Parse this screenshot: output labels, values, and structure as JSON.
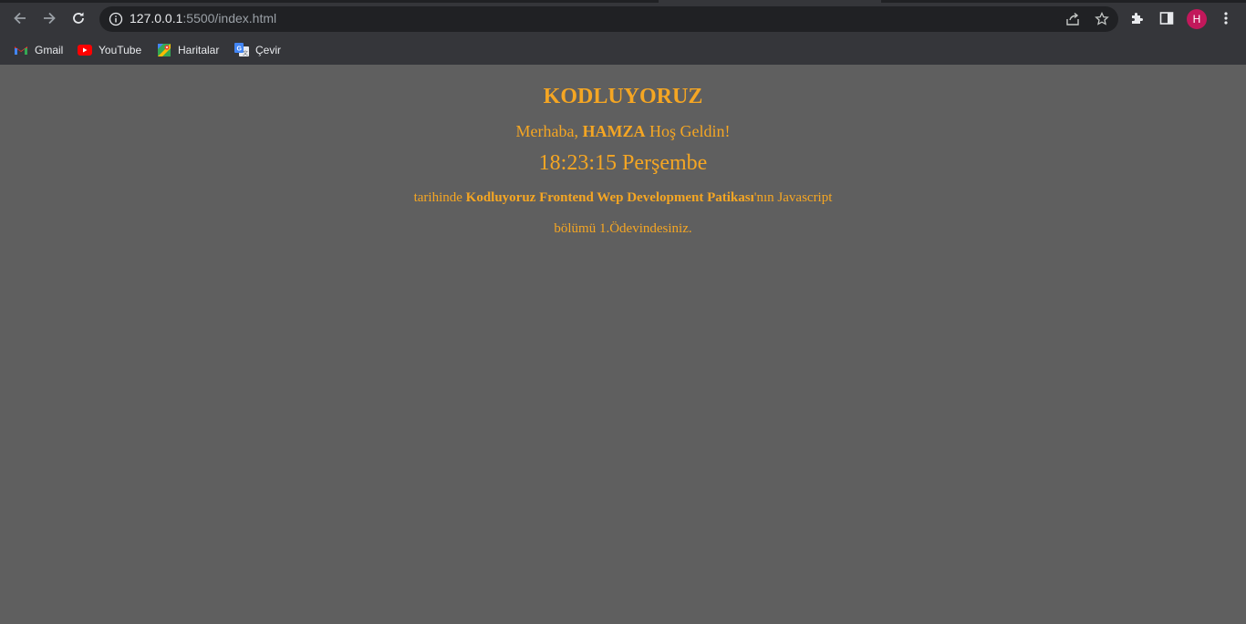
{
  "browser": {
    "url_host": "127.0.0.1",
    "url_rest": ":5500/index.html",
    "profile_initial": "H",
    "bookmarks": [
      {
        "label": "Gmail",
        "icon": "gmail-icon"
      },
      {
        "label": "YouTube",
        "icon": "youtube-icon"
      },
      {
        "label": "Haritalar",
        "icon": "maps-icon"
      },
      {
        "label": "Çevir",
        "icon": "translate-icon"
      }
    ]
  },
  "page": {
    "title": "KODLUYORUZ",
    "greeting_prefix": "Merhaba,",
    "user_name": "HAMZA",
    "greeting_suffix": "Hoş Geldin!",
    "clock": "18:23:15 Perşembe",
    "line1_prefix": "tarihinde",
    "line1_bold": "Kodluyoruz Frontend Wep Development Patikası",
    "line1_suffix": "'nın Javascript",
    "line2": "bölümü 1.Ödevindesiniz."
  },
  "colors": {
    "page_background": "#5f5f5f",
    "text_accent": "#f5a623",
    "avatar": "#c2185b"
  }
}
